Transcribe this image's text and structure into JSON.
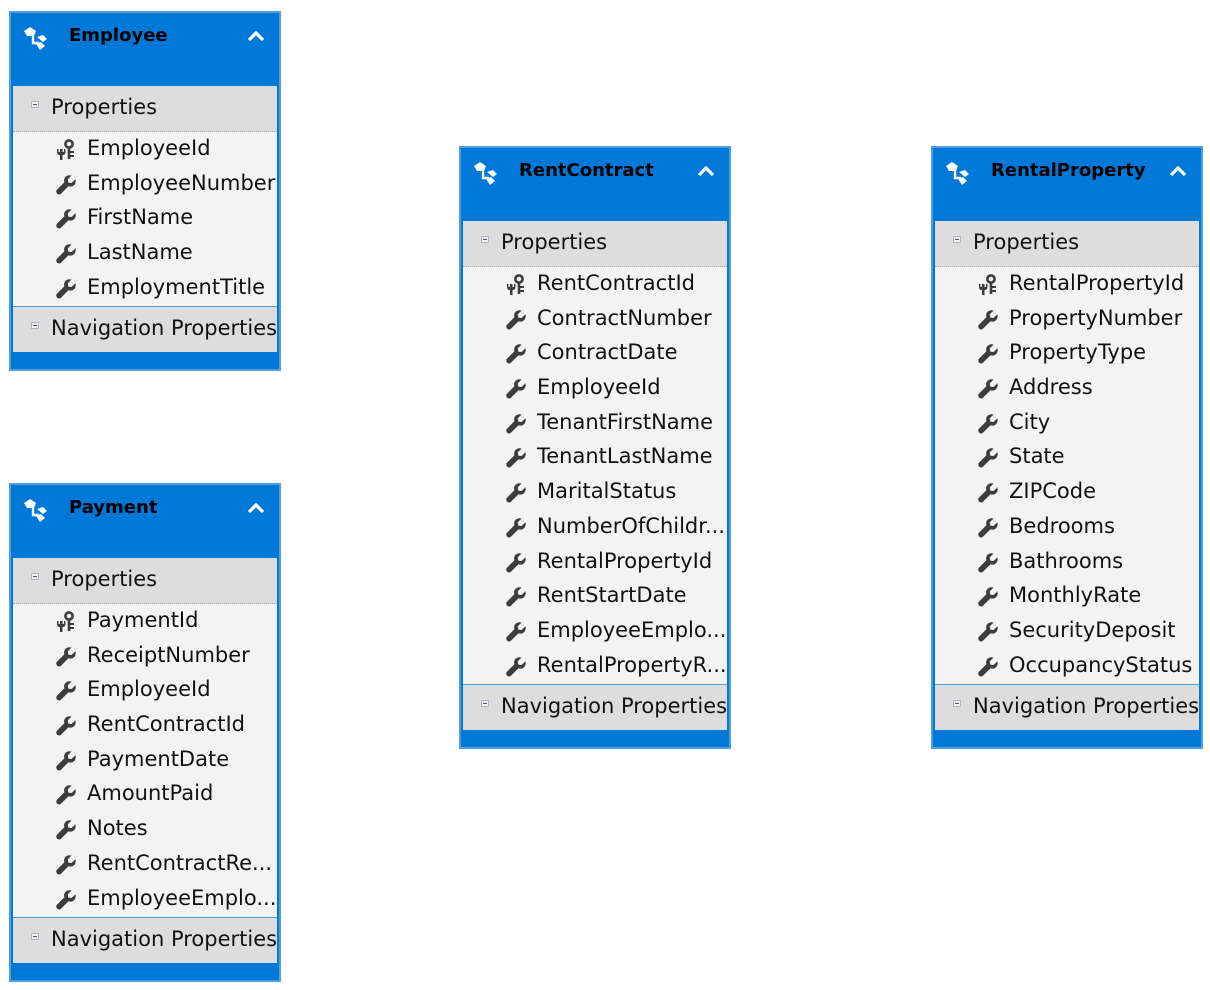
{
  "diagram": {
    "type": "entity-data-model",
    "accent_color": "#0078d7",
    "section_labels": {
      "properties": "Properties",
      "navigation": "Navigation Properties"
    },
    "entities": [
      {
        "name": "Employee",
        "icon": "entity-icon",
        "properties": [
          {
            "name": "EmployeeId",
            "icon": "key-icon"
          },
          {
            "name": "EmployeeNumber",
            "icon": "wrench-icon"
          },
          {
            "name": "FirstName",
            "icon": "wrench-icon"
          },
          {
            "name": "LastName",
            "icon": "wrench-icon"
          },
          {
            "name": "EmploymentTitle",
            "icon": "wrench-icon"
          }
        ]
      },
      {
        "name": "Payment",
        "icon": "entity-icon",
        "properties": [
          {
            "name": "PaymentId",
            "icon": "key-icon"
          },
          {
            "name": "ReceiptNumber",
            "icon": "wrench-icon"
          },
          {
            "name": "EmployeeId",
            "icon": "wrench-icon"
          },
          {
            "name": "RentContractId",
            "icon": "wrench-icon"
          },
          {
            "name": "PaymentDate",
            "icon": "wrench-icon"
          },
          {
            "name": "AmountPaid",
            "icon": "wrench-icon"
          },
          {
            "name": "Notes",
            "icon": "wrench-icon"
          },
          {
            "name": "RentContractRe...",
            "icon": "wrench-icon"
          },
          {
            "name": "EmployeeEmplo...",
            "icon": "wrench-icon"
          }
        ]
      },
      {
        "name": "RentContract",
        "icon": "entity-icon",
        "properties": [
          {
            "name": "RentContractId",
            "icon": "key-icon"
          },
          {
            "name": "ContractNumber",
            "icon": "wrench-icon"
          },
          {
            "name": "ContractDate",
            "icon": "wrench-icon"
          },
          {
            "name": "EmployeeId",
            "icon": "wrench-icon"
          },
          {
            "name": "TenantFirstName",
            "icon": "wrench-icon"
          },
          {
            "name": "TenantLastName",
            "icon": "wrench-icon"
          },
          {
            "name": "MaritalStatus",
            "icon": "wrench-icon"
          },
          {
            "name": "NumberOfChildr...",
            "icon": "wrench-icon"
          },
          {
            "name": "RentalPropertyId",
            "icon": "wrench-icon"
          },
          {
            "name": "RentStartDate",
            "icon": "wrench-icon"
          },
          {
            "name": "EmployeeEmplo...",
            "icon": "wrench-icon"
          },
          {
            "name": "RentalPropertyR...",
            "icon": "wrench-icon"
          }
        ]
      },
      {
        "name": "RentalProperty",
        "icon": "entity-icon",
        "properties": [
          {
            "name": "RentalPropertyId",
            "icon": "key-icon"
          },
          {
            "name": "PropertyNumber",
            "icon": "wrench-icon"
          },
          {
            "name": "PropertyType",
            "icon": "wrench-icon"
          },
          {
            "name": "Address",
            "icon": "wrench-icon"
          },
          {
            "name": "City",
            "icon": "wrench-icon"
          },
          {
            "name": "State",
            "icon": "wrench-icon"
          },
          {
            "name": "ZIPCode",
            "icon": "wrench-icon"
          },
          {
            "name": "Bedrooms",
            "icon": "wrench-icon"
          },
          {
            "name": "Bathrooms",
            "icon": "wrench-icon"
          },
          {
            "name": "MonthlyRate",
            "icon": "wrench-icon"
          },
          {
            "name": "SecurityDeposit",
            "icon": "wrench-icon"
          },
          {
            "name": "OccupancyStatus",
            "icon": "wrench-icon"
          }
        ]
      }
    ]
  }
}
